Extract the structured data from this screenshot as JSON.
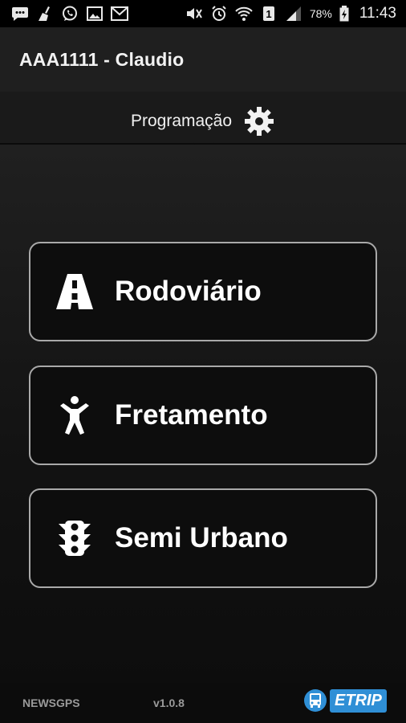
{
  "status_bar": {
    "battery_percent": "78%",
    "time": "11:43",
    "sim_slot": "1",
    "left_icons": [
      "chat-icon",
      "broom-icon",
      "whatsapp-icon",
      "gallery-icon",
      "gmail-icon"
    ],
    "right_icons": [
      "mute-icon",
      "alarm-icon",
      "wifi-icon",
      "sim-icon",
      "signal-icon",
      "battery-icon"
    ]
  },
  "app_bar": {
    "title": "AAA1111 - Claudio"
  },
  "tab": {
    "label": "Programação",
    "icon": "gear-icon"
  },
  "menu": {
    "items": [
      {
        "label": "Rodoviário",
        "icon": "road-icon"
      },
      {
        "label": "Fretamento",
        "icon": "person-icon"
      },
      {
        "label": "Semi Urbano",
        "icon": "traffic-light-icon"
      }
    ]
  },
  "footer": {
    "company": "NEWSGPS",
    "version": "v1.0.8",
    "logo_text": "ETRIP"
  },
  "colors": {
    "status_bar_bg": "#000000",
    "app_bar_bg": "#1f1f1f",
    "button_border": "#a9a9a9",
    "logo_blue": "#2f8fd6"
  }
}
